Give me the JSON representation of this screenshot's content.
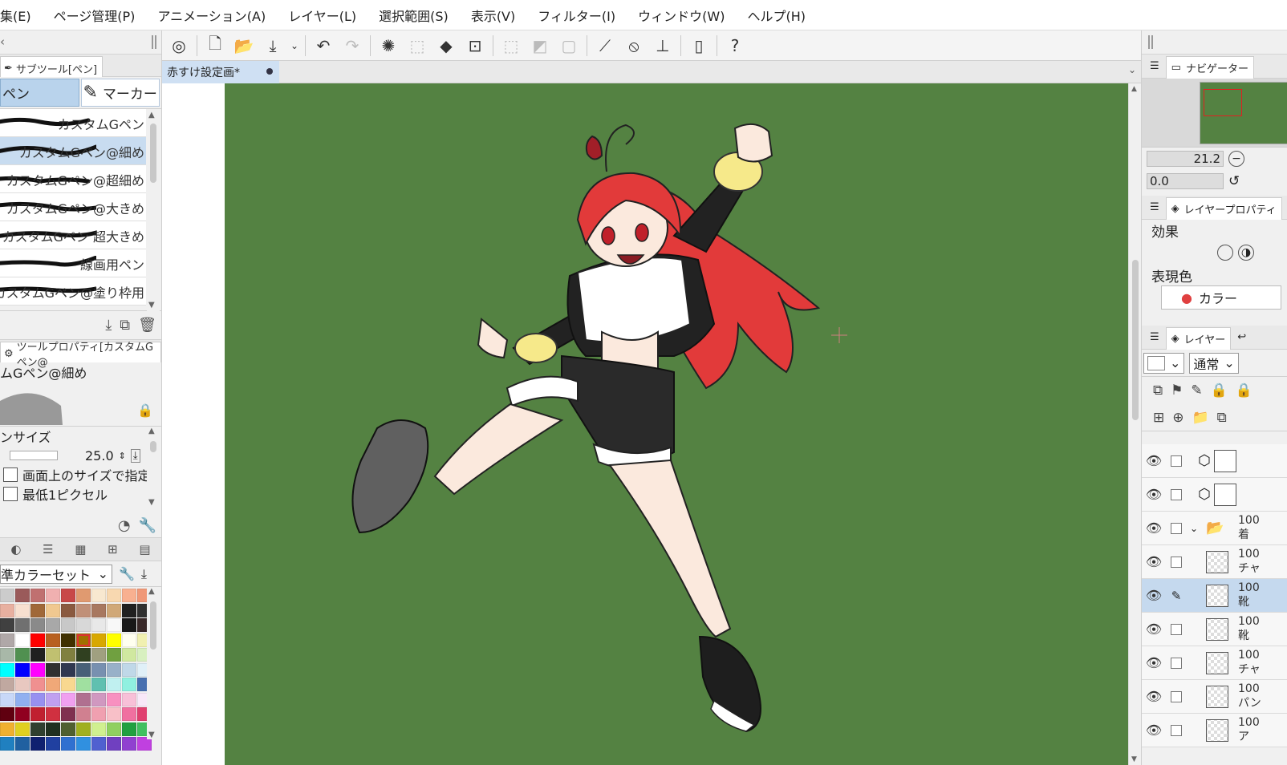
{
  "menubar": {
    "items": [
      "集(E)",
      "ページ管理(P)",
      "アニメーション(A)",
      "レイヤー(L)",
      "選択範囲(S)",
      "表示(V)",
      "フィルター(I)",
      "ウィンドウ(W)",
      "ヘルプ(H)"
    ]
  },
  "subtool": {
    "header": "サブツール[ペン]",
    "tabs": [
      "ペン",
      "マーカー"
    ],
    "brushes": [
      "カスタムGペン",
      "カスタムGペン@細め",
      "カスタムGペン@超細め",
      "カスタムGペン@大きめ",
      "カスタムGペン 超大きめ",
      "線画用ペン",
      "カスタムGペン@塗り枠用"
    ],
    "selected_index": 1
  },
  "tool_property": {
    "header": "ツールプロパティ[カスタムGペン@",
    "brush_name": "ムGペン@細め",
    "size_label": "ンサイズ",
    "size_value": "25.0",
    "option1": "画面上のサイズで指定",
    "option2": "最低1ピクセル"
  },
  "color_set": {
    "name": "準カラーセット",
    "swatches": [
      "#cccccc",
      "#9a5a5a",
      "#c07070",
      "#f0b0b0",
      "#c84848",
      "#e09a70",
      "#f8e8d0",
      "#f8d8b0",
      "#f8b090",
      "#f09878",
      "#e8b0a0",
      "#f8e0d0",
      "#a06838",
      "#f0c890",
      "#8a5a40",
      "#c09078",
      "#a87860",
      "#d0a878",
      "#202020",
      "#303030",
      "#404040",
      "#707070",
      "#8a8a8a",
      "#a8a8a8",
      "#c8c8c8",
      "#d8d8d8",
      "#e8e8e8",
      "#f8f8f8",
      "#181818",
      "#382828",
      "#b0a8a8",
      "#ffffff",
      "#ff0000",
      "#b86020",
      "#403000",
      "#a07000",
      "#d8a800",
      "#ffff00",
      "#fffff0",
      "#f0f0b0",
      "#a8b8a8",
      "#509050",
      "#202020",
      "#c0c070",
      "#808040",
      "#304020",
      "#a0a080",
      "#70a040",
      "#d0e8a0",
      "#d8f0c0",
      "#00ffff",
      "#0000ff",
      "#ff00ff",
      "#303030",
      "#303850",
      "#486078",
      "#7890b0",
      "#98b0c8",
      "#c0d8e8",
      "#e0f0f8",
      "#c0a8a0",
      "#e8c8c0",
      "#f09090",
      "#f0a878",
      "#f8d890",
      "#a0e0a0",
      "#60c0b0",
      "#c0f0f0",
      "#90f0e0",
      "#4870b0",
      "#c8d8f8",
      "#90b0f0",
      "#9890f0",
      "#c0a0f0",
      "#f0a0f0",
      "#b07090",
      "#d098c0",
      "#f890c0",
      "#f8c0d8",
      "#f8e8f8",
      "#600010",
      "#900020",
      "#c02030",
      "#d03040",
      "#803050",
      "#d08090",
      "#f0a0b0",
      "#f8c0c8",
      "#f070a0",
      "#e04070",
      "#f0b030",
      "#e0d020",
      "#304030",
      "#203020",
      "#506030",
      "#a0b020",
      "#d0f090",
      "#90d060",
      "#20a040",
      "#40c060",
      "#2080c0",
      "#2060a0",
      "#102070",
      "#2040a0",
      "#3070d0",
      "#3090e0",
      "#5060d0",
      "#7040c0",
      "#9040d0",
      "#c040e0"
    ],
    "selected_index": 35
  },
  "document": {
    "tab_title": "赤すけ設定画*"
  },
  "navigator": {
    "header": "ナビゲーター",
    "zoom": "21.2",
    "rotation": "0.0"
  },
  "layer_property": {
    "header": "レイヤープロパティ",
    "effect_label": "効果",
    "color_label": "表現色",
    "color_value": "カラー"
  },
  "layers": {
    "header": "レイヤー",
    "blend_mode": "通常",
    "rows": [
      {
        "name": "",
        "kind": "3d",
        "selected": false
      },
      {
        "name": "",
        "kind": "3d",
        "selected": false
      },
      {
        "name": "100\n着",
        "kind": "folder",
        "selected": false
      },
      {
        "name": "100\nチャ",
        "kind": "raster",
        "selected": false
      },
      {
        "name": "100\n靴",
        "kind": "raster",
        "selected": true
      },
      {
        "name": "100\n靴",
        "kind": "raster",
        "selected": false
      },
      {
        "name": "100\nチャ",
        "kind": "raster",
        "selected": false
      },
      {
        "name": "100\nパン",
        "kind": "raster",
        "selected": false
      },
      {
        "name": "100\nア",
        "kind": "raster",
        "selected": false
      }
    ]
  }
}
